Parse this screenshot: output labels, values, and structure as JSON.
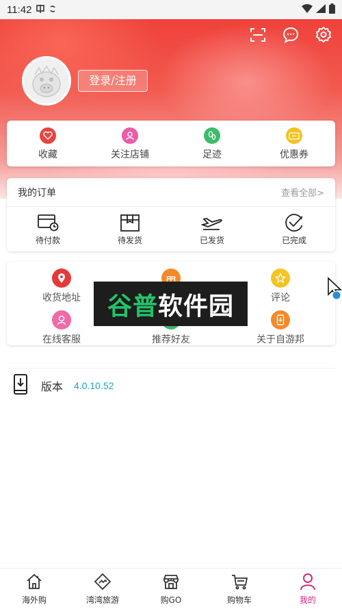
{
  "status_bar": {
    "time": "11:42",
    "icons": [
      "carrier-icon",
      "sync-icon",
      "wifi-icon",
      "signal-icon",
      "battery-icon"
    ]
  },
  "header": {
    "top_icons": [
      "scan-icon",
      "message-icon",
      "settings-icon"
    ],
    "login_label": "登录/注册"
  },
  "quick_links": [
    {
      "label": "收藏",
      "icon": "heart-icon",
      "color": "#e8443e"
    },
    {
      "label": "关注店铺",
      "icon": "user-follow-icon",
      "color": "#ec5aa9"
    },
    {
      "label": "足迹",
      "icon": "footprint-icon",
      "color": "#3dbb6a"
    },
    {
      "label": "优惠券",
      "icon": "coupon-icon",
      "color": "#f2c21e"
    }
  ],
  "orders": {
    "title": "我的订单",
    "view_all": "查看全部>",
    "items": [
      {
        "label": "待付款",
        "icon": "card-clock-icon"
      },
      {
        "label": "待发货",
        "icon": "box-icon"
      },
      {
        "label": "已发货",
        "icon": "plane-icon"
      },
      {
        "label": "已完成",
        "icon": "check-circle-icon"
      }
    ]
  },
  "services": [
    {
      "label": "收货地址",
      "icon": "location-icon",
      "color": "#e6393a"
    },
    {
      "label": "",
      "icon": "gift-icon",
      "color": "#f28a2b"
    },
    {
      "label": "评论",
      "icon": "star-icon",
      "color": "#f5c422"
    },
    {
      "label": "在线客服",
      "icon": "customer-service-icon",
      "color": "#ef6aa6"
    },
    {
      "label": "推荐好友",
      "icon": "recommend-icon",
      "color": "#3bb56a"
    },
    {
      "label": "关于自游邦",
      "icon": "phone-info-icon",
      "color": "#f58a2a"
    }
  ],
  "watermark": {
    "part1": "谷普",
    "part2": "软件园"
  },
  "version": {
    "label": "版本",
    "value": "4.0.10.52"
  },
  "bottom_nav": [
    {
      "label": "海外购",
      "icon": "home-icon",
      "active": false
    },
    {
      "label": "湾湾旅游",
      "icon": "diamond-map-icon",
      "active": false
    },
    {
      "label": "购GO",
      "icon": "store-icon",
      "active": false
    },
    {
      "label": "购物车",
      "icon": "cart-icon",
      "active": false
    },
    {
      "label": "我的",
      "icon": "profile-icon",
      "active": true
    }
  ],
  "colors": {
    "accent": "#d8267c",
    "header_red": "#ee3b35",
    "version_blue": "#1aa3c6"
  }
}
